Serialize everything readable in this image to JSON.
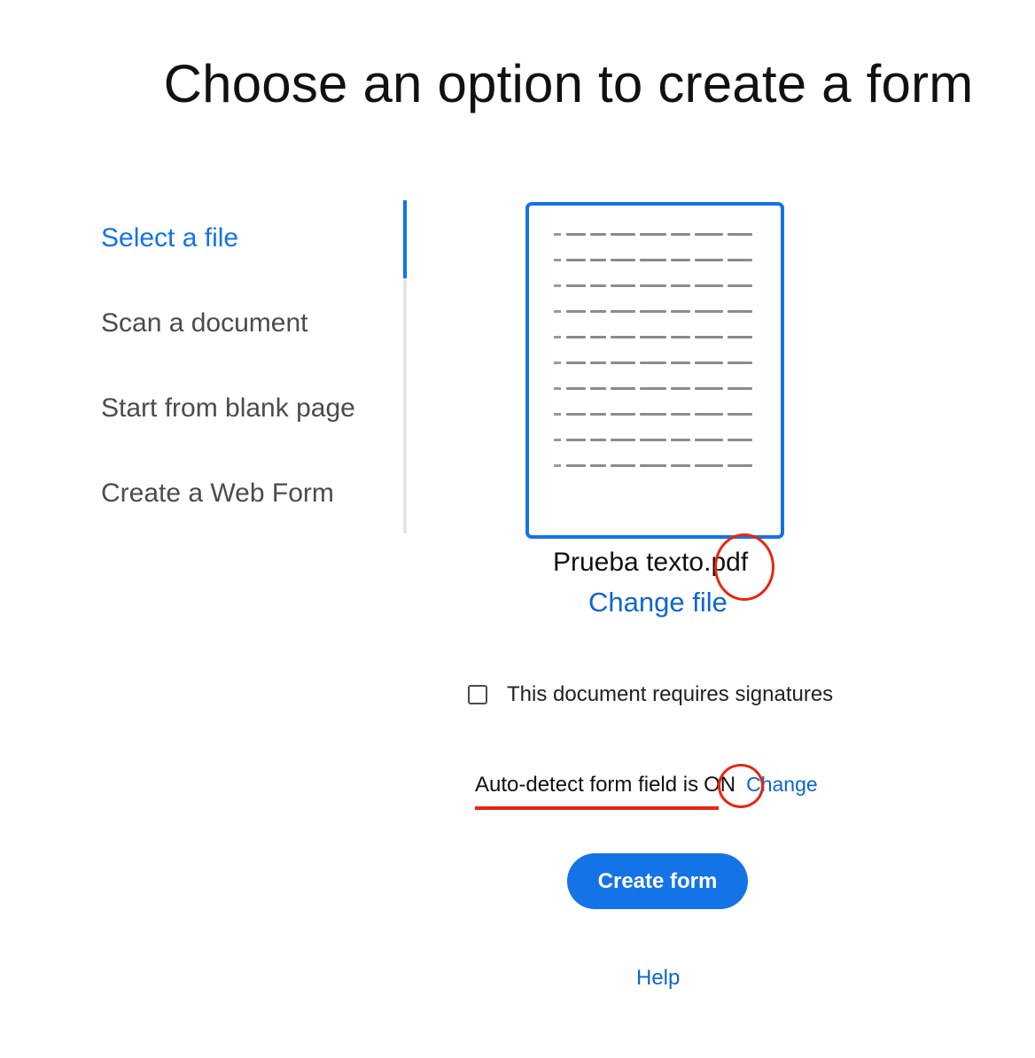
{
  "page": {
    "title": "Choose an option to create a form"
  },
  "nav": {
    "items": [
      {
        "label": "Select a file",
        "active": true
      },
      {
        "label": "Scan a document",
        "active": false
      },
      {
        "label": "Start from blank page",
        "active": false
      },
      {
        "label": "Create a Web Form",
        "active": false
      }
    ]
  },
  "file": {
    "name": "Prueba texto.pdf",
    "change_label": "Change file"
  },
  "signature": {
    "label": "This document requires signatures",
    "checked": false
  },
  "autodetect": {
    "text": "Auto-detect form field is",
    "state": "ON",
    "change_label": "Change"
  },
  "actions": {
    "create_label": "Create form",
    "help_label": "Help"
  },
  "colors": {
    "accent": "#1473e6",
    "link": "#0d66d0",
    "annotation": "#e8260f"
  }
}
